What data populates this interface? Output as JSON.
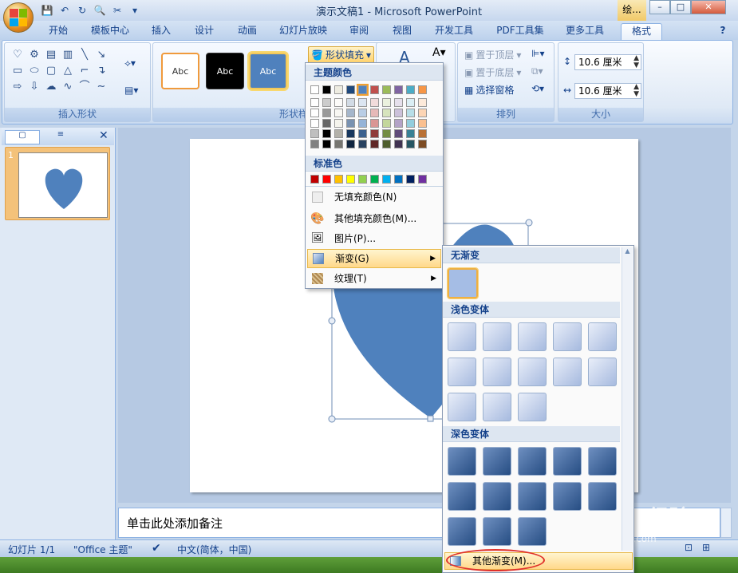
{
  "window": {
    "title": "演示文稿1 - Microsoft PowerPoint",
    "context_tab_title": "绘...",
    "min_label": "–",
    "max_label": "□",
    "close_label": "✕"
  },
  "qat": {
    "save": "💾",
    "undo": "↶",
    "redo": "↻",
    "print_preview": "🔍",
    "cut": "✂",
    "more": "▾"
  },
  "tabs": [
    "开始",
    "模板中心",
    "插入",
    "设计",
    "动画",
    "幻灯片放映",
    "审阅",
    "视图",
    "开发工具",
    "PDF工具集",
    "更多工具",
    "格式"
  ],
  "active_tab": "格式",
  "ribbon": {
    "insert_shapes": {
      "label": "插入形状"
    },
    "shape_styles": {
      "label": "形状样式",
      "thumb_text": "Abc",
      "fill_button": "形状填充"
    },
    "arrange": {
      "label": "排列",
      "bring_front": "置于顶层",
      "send_back": "置于底层",
      "selection_pane": "选择窗格"
    },
    "size": {
      "label": "大小",
      "height": "10.6 厘米",
      "width": "10.6 厘米"
    }
  },
  "slides_pane": {
    "slide_number": "1"
  },
  "notes": {
    "placeholder": "单击此处添加备注"
  },
  "statusbar": {
    "slide": "幻灯片 1/1",
    "theme": "\"Office 主题\"",
    "language": "中文(简体，中国)"
  },
  "fill_menu": {
    "theme_colors_header": "主题颜色",
    "standard_colors_header": "标准色",
    "no_fill": "无填充颜色(N)",
    "more_colors": "其他填充颜色(M)...",
    "picture": "图片(P)...",
    "gradient": "渐变(G)",
    "texture": "纹理(T)",
    "colors": {
      "theme_top": [
        "#ffffff",
        "#000000",
        "#eeece1",
        "#1f497d",
        "#4f81bd",
        "#c0504d",
        "#9bbb59",
        "#8064a2",
        "#4bacc6",
        "#f79646"
      ],
      "standard": [
        "#c00000",
        "#ff0000",
        "#ffc000",
        "#ffff00",
        "#92d050",
        "#00b050",
        "#00b0f0",
        "#0070c0",
        "#002060",
        "#7030a0"
      ]
    }
  },
  "gradient_menu": {
    "none_header": "无渐变",
    "light_header": "浅色变体",
    "dark_header": "深色变体",
    "more": "其他渐变(M)..."
  },
  "watermark": {
    "brand": "Bai du 经验",
    "url": "jingyan.baidu.com"
  }
}
